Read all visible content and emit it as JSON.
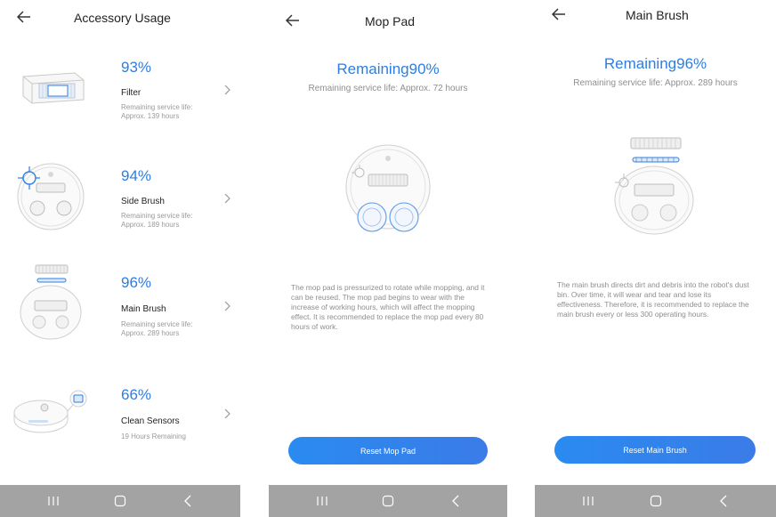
{
  "accessory_usage": {
    "title": "Accessory Usage",
    "items": [
      {
        "percent": "93%",
        "name": "Filter",
        "subtitle": "Remaining service life: Approx. 139 hours",
        "image_icon": "filter-image-icon"
      },
      {
        "percent": "94%",
        "name": "Side Brush",
        "subtitle": "Remaining service life: Approx. 189 hours",
        "image_icon": "side-brush-image-icon"
      },
      {
        "percent": "96%",
        "name": "Main Brush",
        "subtitle": "Remaining service life: Approx. 289 hours",
        "image_icon": "main-brush-image-icon"
      },
      {
        "percent": "66%",
        "name": "Clean Sensors",
        "subtitle": "19 Hours Remaining",
        "image_icon": "sensors-image-icon"
      }
    ]
  },
  "mop_pad": {
    "title": "Mop Pad",
    "remaining": "Remaining90%",
    "service_life": "Remaining service life: Approx. 72 hours",
    "description": "The mop pad is pressurized to rotate while mopping, and it can be reused. The mop pad begins to wear with the increase of working hours, which will affect the mopping effect. It is recommended to replace the mop pad every 80 hours of work.",
    "reset_label": "Reset Mop Pad"
  },
  "main_brush": {
    "title": "Main Brush",
    "remaining": "Remaining96%",
    "service_life": "Remaining service life: Approx. 289 hours",
    "description": "The main brush directs dirt and debris into the robot's dust bin. Over time, it will wear and tear and lose its effectiveness. Therefore, it is recommended to replace the main brush every or less 300 operating hours.",
    "reset_label": "Reset Main Brush"
  },
  "colors": {
    "accent": "#2e7de0",
    "navbar": "#a3a3a3",
    "muted_text": "#8e8e8e"
  },
  "icons": {
    "back": "back-arrow-icon",
    "chevron": "chevron-right-icon",
    "nav_recents": "recents-icon",
    "nav_home": "home-icon",
    "nav_back": "nav-back-icon"
  }
}
